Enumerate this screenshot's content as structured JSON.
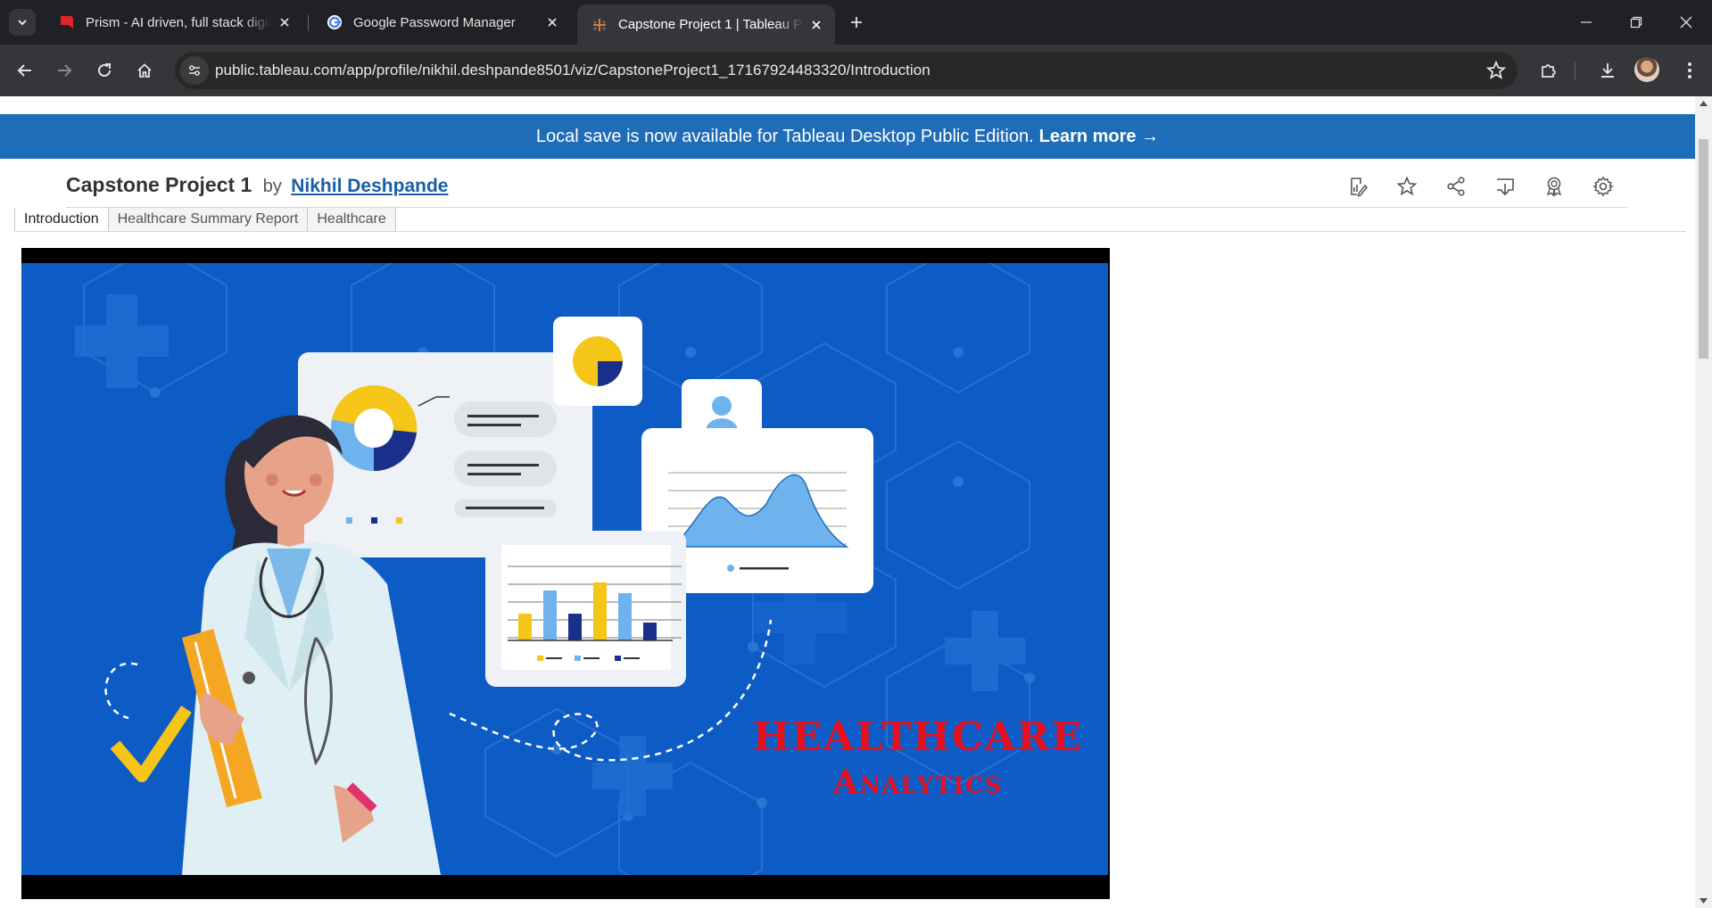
{
  "browser": {
    "tabs": [
      {
        "title": "Prism - AI driven, full stack digit",
        "favicon": "prism-icon",
        "active": false
      },
      {
        "title": "Google Password Manager",
        "favicon": "google-icon",
        "active": false
      },
      {
        "title": "Capstone Project 1 | Tableau Pu",
        "favicon": "tableau-icon",
        "active": true
      }
    ],
    "url": "public.tableau.com/app/profile/nikhil.deshpande8501/viz/CapstoneProject1_17167924483320/Introduction"
  },
  "banner": {
    "text": "Local save is now available for Tableau Desktop Public Edition.",
    "link": "Learn more →"
  },
  "viz": {
    "title": "Capstone Project 1",
    "by": "by",
    "author": "Nikhil Deshpande",
    "toolbar_icons": [
      "edit-icon",
      "favorite-star-icon",
      "share-icon",
      "download-icon",
      "badge-icon",
      "settings-gear-icon"
    ]
  },
  "sheet_tabs": [
    {
      "label": "Introduction",
      "active": true
    },
    {
      "label": "Healthcare Summary Report",
      "active": false
    },
    {
      "label": "Healthcare",
      "active": false
    }
  ],
  "dashboard": {
    "headline_line1": "HEALTHCARE",
    "headline_line2": "Analytics",
    "colors": {
      "background": "#0d5bc4",
      "headline": "#e8101e",
      "accent_yellow": "#f5c518",
      "accent_navy": "#1a2f8a"
    }
  }
}
